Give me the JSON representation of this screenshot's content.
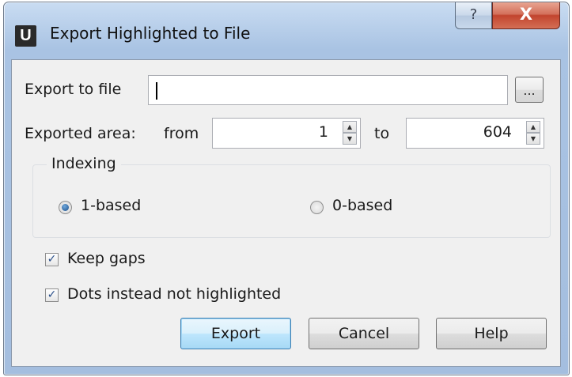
{
  "window": {
    "title": "Export Highlighted to File",
    "app_icon_letter": "U",
    "help_glyph": "?",
    "close_glyph": "X"
  },
  "export_file": {
    "label": "Export to file",
    "value": "",
    "browse_label": "..."
  },
  "area": {
    "label": "Exported area:",
    "from_label": "from",
    "from_value": "1",
    "to_label": "to",
    "to_value": "604"
  },
  "indexing": {
    "title": "Indexing",
    "options": [
      {
        "label": "1-based",
        "checked": true
      },
      {
        "label": "0-based",
        "checked": false
      }
    ]
  },
  "options": {
    "keep_gaps": {
      "label": "Keep gaps",
      "checked": true
    },
    "dots": {
      "label": "Dots instead not highlighted",
      "checked": true
    }
  },
  "buttons": {
    "export": "Export",
    "cancel": "Cancel",
    "help": "Help"
  },
  "glyphs": {
    "check": "✓",
    "spin_up": "▲",
    "spin_down": "▼"
  }
}
